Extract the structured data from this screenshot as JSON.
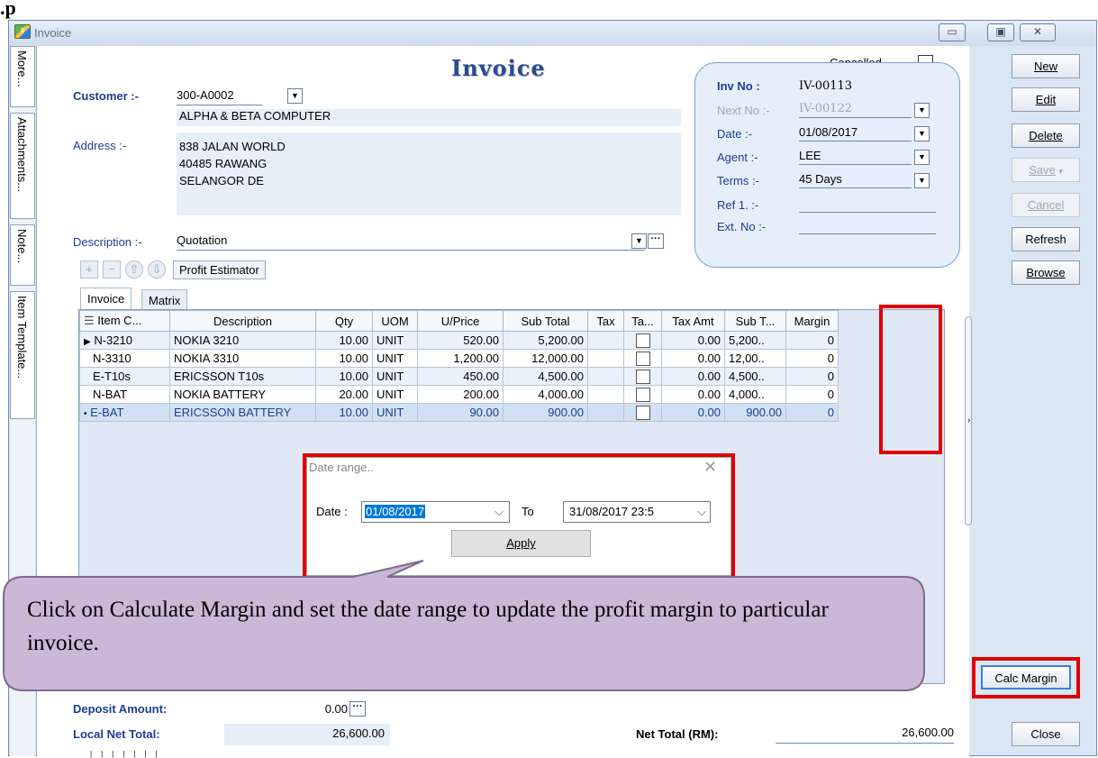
{
  "window": {
    "title": "Invoice",
    "minimize": "▭",
    "restore": "▣",
    "close": "✕"
  },
  "side_tabs": [
    "More...",
    "Attachments...",
    "Note...",
    "Item Template..."
  ],
  "form": {
    "title": "Invoice",
    "cancelled_label": "Cancelled",
    "customer_label": "Customer :-",
    "customer_code": "300-A0002",
    "customer_name": "ALPHA & BETA COMPUTER",
    "address_label": "Address :-",
    "address_lines": [
      "838 JALAN WORLD",
      "40485 RAWANG",
      "SELANGOR DE"
    ],
    "description_label": "Description :-",
    "description": "Quotation",
    "profit_estimator": "Profit Estimator"
  },
  "info": {
    "inv_no_label": "Inv No :",
    "inv_no": "IV-00113",
    "next_no_label": "Next No :-",
    "next_no": "IV-00122",
    "date_label": "Date :-",
    "date": "01/08/2017",
    "agent_label": "Agent :-",
    "agent": "LEE",
    "terms_label": "Terms :-",
    "terms": "45 Days",
    "ref1_label": "Ref 1. :-",
    "ext_no_label": "Ext. No :-"
  },
  "tabs": [
    "Invoice",
    "Matrix"
  ],
  "grid": {
    "headers": [
      "Item C...",
      "Description",
      "Qty",
      "UOM",
      "U/Price",
      "Sub Total",
      "Tax",
      "Ta...",
      "Tax Amt",
      "Sub T...",
      "Margin"
    ],
    "rows": [
      {
        "code": "N-3210",
        "desc": "NOKIA 3210",
        "qty": "10.00",
        "uom": "UNIT",
        "price": "520.00",
        "subtotal": "5,200.00",
        "taxamt": "0.00",
        "subt": "5,200..",
        "margin": "0"
      },
      {
        "code": "N-3310",
        "desc": "NOKIA 3310",
        "qty": "10.00",
        "uom": "UNIT",
        "price": "1,200.00",
        "subtotal": "12,000.00",
        "taxamt": "0.00",
        "subt": "12,00..",
        "margin": "0"
      },
      {
        "code": "E-T10s",
        "desc": "ERICSSON T10s",
        "qty": "10.00",
        "uom": "UNIT",
        "price": "450.00",
        "subtotal": "4,500.00",
        "taxamt": "0.00",
        "subt": "4,500..",
        "margin": "0"
      },
      {
        "code": "N-BAT",
        "desc": "NOKIA BATTERY",
        "qty": "20.00",
        "uom": "UNIT",
        "price": "200.00",
        "subtotal": "4,000.00",
        "taxamt": "0.00",
        "subt": "4,000..",
        "margin": "0"
      },
      {
        "code": "E-BAT",
        "desc": "ERICSSON BATTERY",
        "qty": "10.00",
        "uom": "UNIT",
        "price": "90.00",
        "subtotal": "900.00",
        "taxamt": "0.00",
        "subt": "900.00",
        "margin": "0"
      }
    ]
  },
  "dialog": {
    "title": "Date range..",
    "date_label": "Date :",
    "from": "01/08/2017",
    "to_label": "To",
    "to": "31/08/2017 23:5",
    "apply": "Apply"
  },
  "callout": "Click on Calculate Margin and set the date range to update the profit margin to particular invoice.",
  "totals": {
    "deposit_label": "Deposit Amount:",
    "deposit": "0.00",
    "local_label": "Local Net Total:",
    "local": "26,600.00",
    "net_label": "Net Total (RM):",
    "net": "26,600.00"
  },
  "buttons": {
    "new": "New",
    "edit": "Edit",
    "delete": "Delete",
    "save": "Save",
    "cancel": "Cancel",
    "refresh": "Refresh",
    "browse": "Browse",
    "calc_margin": "Calc Margin",
    "close": "Close"
  }
}
